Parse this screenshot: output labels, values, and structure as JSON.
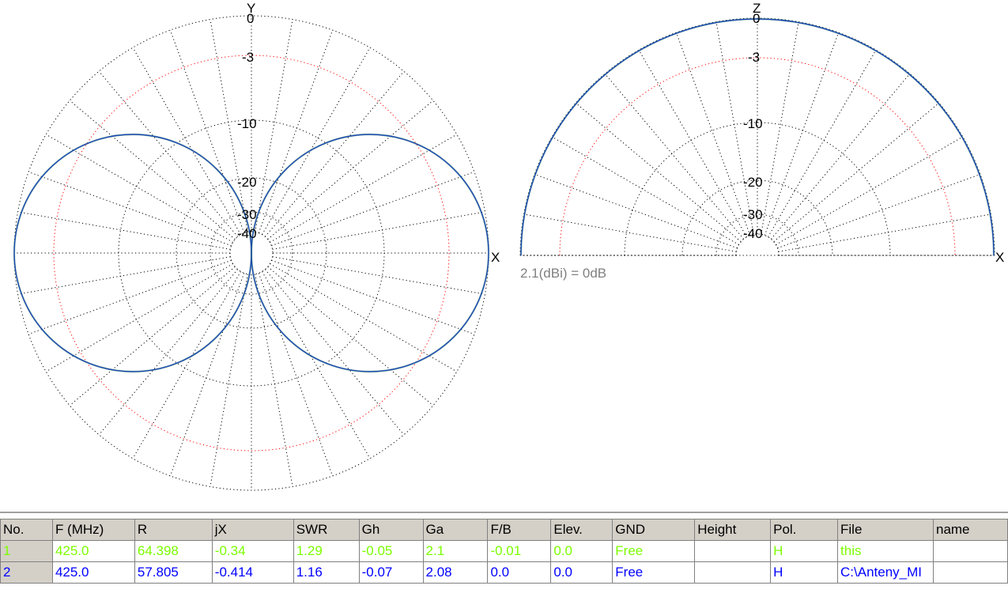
{
  "colors": {
    "pattern_line": "#1a3fbf",
    "pattern_edge": "#2e8b57",
    "grid_black": "#000000",
    "grid_red": "#ff0000",
    "row1_text": "#7cfc00",
    "row2_text": "#0000ff",
    "header_bg": "#d4d0c8"
  },
  "azimuth_plot": {
    "axis_top": "Y",
    "axis_right": "X",
    "ring_labels": [
      "0",
      "-3",
      "-10",
      "-20",
      "-30",
      "-40"
    ]
  },
  "elevation_plot": {
    "axis_top": "Z",
    "axis_right": "X",
    "ring_labels": [
      "0",
      "-3",
      "-10",
      "-20",
      "-30",
      "-40"
    ],
    "gain_note": "2.1(dBi) = 0dB"
  },
  "table": {
    "columns": [
      "No.",
      "F (MHz)",
      "R",
      "jX",
      "SWR",
      "Gh",
      "Ga",
      "F/B",
      "Elev.",
      "GND",
      "Height",
      "Pol.",
      "File",
      "name"
    ],
    "rows": [
      [
        "1",
        "425.0",
        "64.398",
        "-0.34",
        "1.29",
        "-0.05",
        "2.1",
        "-0.01",
        "0.0",
        "Free",
        "",
        "H",
        "this",
        ""
      ],
      [
        "2",
        "425.0",
        "57.805",
        "-0.414",
        "1.16",
        "-0.07",
        "2.08",
        "0.0",
        "0.0",
        "Free",
        "",
        "H",
        "C:\\Anteny_MI",
        ""
      ]
    ]
  }
}
